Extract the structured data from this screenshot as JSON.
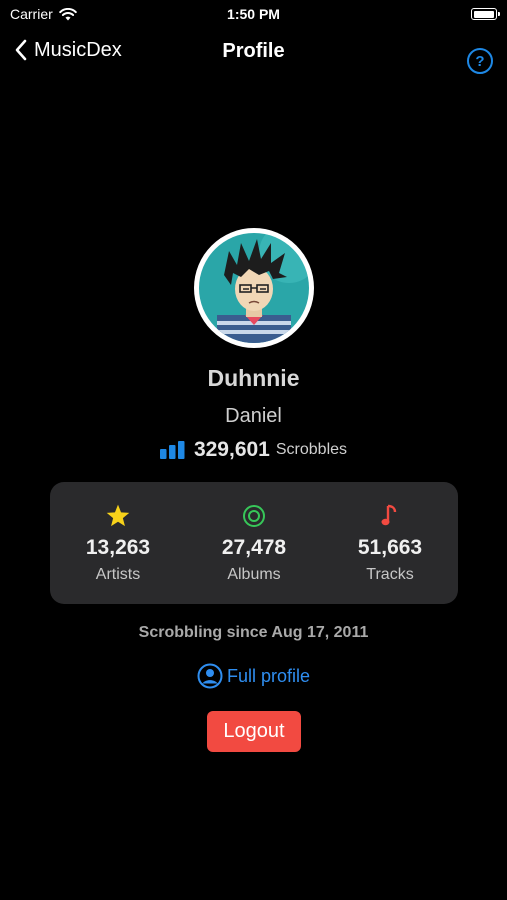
{
  "status_bar": {
    "carrier": "Carrier",
    "time": "1:50 PM",
    "battery_level": 1.0
  },
  "nav": {
    "back_label": "MusicDex",
    "title": "Profile",
    "help_symbol": "?"
  },
  "profile": {
    "username": "Duhnnie",
    "real_name": "Daniel",
    "scrobbles_count": "329,601",
    "scrobbles_label": "Scrobbles"
  },
  "stats": [
    {
      "icon": "star-icon",
      "value": "13,263",
      "label": "Artists",
      "color": "#f7d21a"
    },
    {
      "icon": "album-icon",
      "value": "27,478",
      "label": "Albums",
      "color": "#37c759"
    },
    {
      "icon": "music-note-icon",
      "value": "51,663",
      "label": "Tracks",
      "color": "#f24a41"
    }
  ],
  "scrobbling_since": "Scrobbling since Aug 17, 2011",
  "full_profile_label": "Full profile",
  "logout_label": "Logout",
  "colors": {
    "accent_blue": "#2f8ef0",
    "logout_red": "#f24a41",
    "card_bg": "#2a2a2c"
  }
}
